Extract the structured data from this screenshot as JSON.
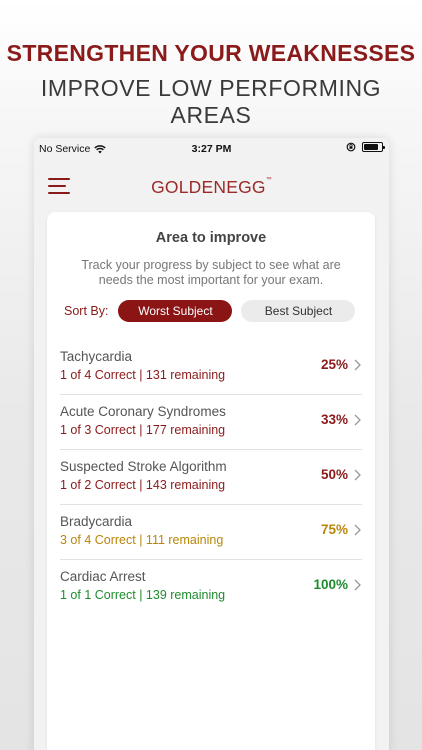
{
  "banner": {
    "line1": "STRENGTHEN YOUR WEAKNESSES",
    "line2": "IMPROVE LOW PERFORMING AREAS"
  },
  "statusbar": {
    "carrier": "No Service",
    "time": "3:27 PM",
    "battery_level": 0.85
  },
  "navbar": {
    "logo": "GOLDENEGG",
    "logo_tm": "™"
  },
  "card": {
    "title": "Area to improve",
    "description": "Track your progress by subject to see what are needs the most important for your exam.",
    "sort_label": "Sort By:",
    "sort_options": [
      "Worst Subject",
      "Best Subject"
    ],
    "sort_selected": "Worst Subject"
  },
  "subjects": [
    {
      "name": "Tachycardia",
      "stats": "1 of 4  Correct | 131 remaining",
      "percent": "25%",
      "color": "#8b1a1a"
    },
    {
      "name": "Acute Coronary Syndromes",
      "stats": "1 of 3  Correct | 177 remaining",
      "percent": "33%",
      "color": "#8b1a1a"
    },
    {
      "name": "Suspected Stroke Algorithm",
      "stats": "1 of 2  Correct | 143 remaining",
      "percent": "50%",
      "color": "#8b1a1a"
    },
    {
      "name": "Bradycardia",
      "stats": "3 of 4  Correct | 111 remaining",
      "percent": "75%",
      "color": "#b8860b"
    },
    {
      "name": "Cardiac Arrest",
      "stats": "1 of 1  Correct | 139 remaining",
      "percent": "100%",
      "color": "#1e8c2e"
    }
  ],
  "colors": {
    "accent": "#8b1a1a",
    "warning": "#b8860b",
    "success": "#1e8c2e"
  }
}
